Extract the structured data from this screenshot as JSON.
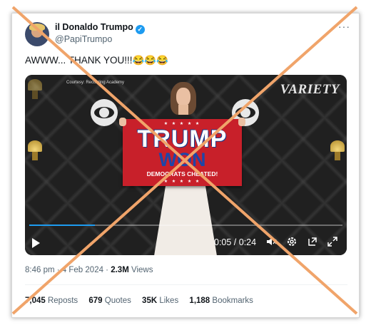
{
  "tweet": {
    "display_name": "il Donaldo Trumpo",
    "verified_glyph": "✓",
    "handle": "@PapiTrumpo",
    "more_glyph": "···",
    "text": "AWWW... THANK YOU!!!😂😂😂"
  },
  "media": {
    "courtesy": "Courtesy: Recording Academy",
    "watermark": "VARIETY",
    "flag": {
      "stars": "★ ★ ★ ★ ★",
      "line1": "TRUMP",
      "line2": "WON",
      "line3": "DEMOCRATS CHEATED!"
    },
    "player": {
      "time": "0:05 / 0:24",
      "progress": 0.21,
      "icons": [
        "play-icon",
        "volume-icon",
        "settings-icon",
        "popout-icon",
        "fullscreen-icon"
      ]
    }
  },
  "meta": {
    "time": "8:46 pm",
    "date": "4 Feb 2024",
    "views_count": "2.3M",
    "views_label": "Views"
  },
  "stats": {
    "reposts_count": "7,045",
    "reposts_label": "Reposts",
    "quotes_count": "679",
    "quotes_label": "Quotes",
    "likes_count": "35K",
    "likes_label": "Likes",
    "bookmarks_count": "1,188",
    "bookmarks_label": "Bookmarks"
  },
  "colors": {
    "accent": "#1d9bf0",
    "cross": "#f0a46a",
    "flag_red": "#c8202a",
    "flag_blue": "#1e46a8"
  }
}
